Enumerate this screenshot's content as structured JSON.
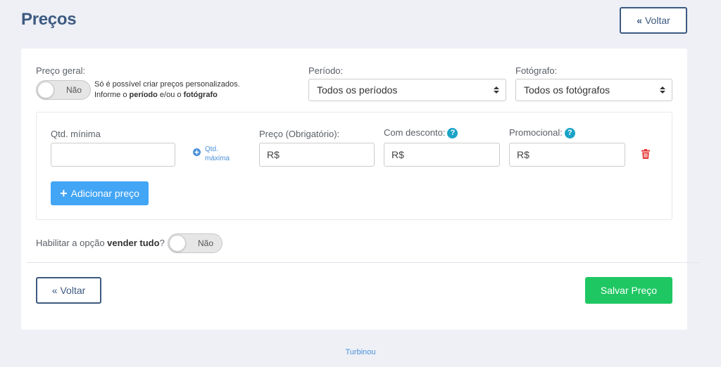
{
  "header": {
    "title": "Preços",
    "back_label": "Voltar"
  },
  "general_price": {
    "label": "Preço geral:",
    "toggle_text": "Não",
    "helper_line1": "Só é possível criar preços personalizados.",
    "helper_prefix": "Informe o ",
    "helper_bold1": "período",
    "helper_mid": " e/ou o ",
    "helper_bold2": "fotógrafo"
  },
  "period": {
    "label": "Período:",
    "selected": "Todos os períodos"
  },
  "photographer": {
    "label": "Fotógrafo:",
    "selected": "Todos os fotógrafos"
  },
  "price_row": {
    "min_qty_label": "Qtd. mínima",
    "min_qty_value": "",
    "max_qty_line1": "Qtd.",
    "max_qty_line2": "máxima",
    "price_label": "Preço (Obrigatório):",
    "price_value": "R$",
    "discount_label": "Com desconto:",
    "discount_value": "R$",
    "promo_label": "Promocional:",
    "promo_value": "R$",
    "help_glyph": "?"
  },
  "add_price_label": "Adicionar preço",
  "sell_all": {
    "prefix": "Habilitar a opção ",
    "bold": "vender tudo",
    "suffix": "?",
    "toggle_text": "Não"
  },
  "footer_actions": {
    "back_label": "Voltar",
    "save_label": "Salvar Preço"
  },
  "footer_text": "Turbinou",
  "colors": {
    "primary": "#3d5a80",
    "add_button": "#42a5f5",
    "save_button": "#1fc763",
    "delete_icon": "#e53935",
    "help_icon": "#1aa3c7"
  }
}
